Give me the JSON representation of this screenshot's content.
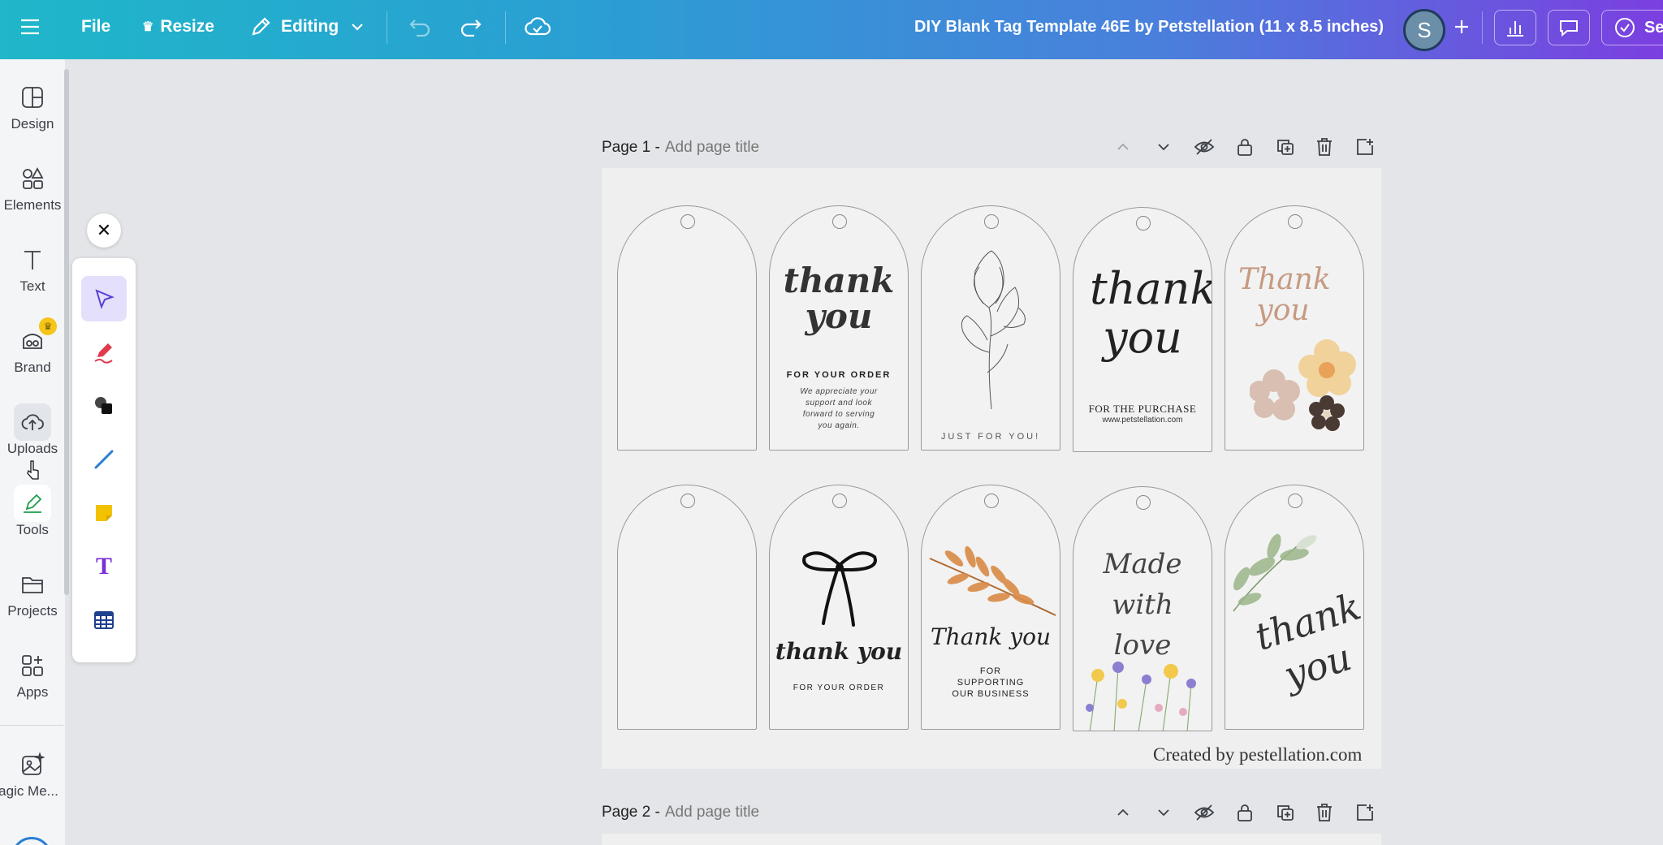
{
  "topbar": {
    "menu_label": "",
    "file_label": "File",
    "resize_label": "Resize",
    "editing_label": "Editing",
    "doc_title": "DIY Blank Tag Template 46E by Petstellation (11 x 8.5 inches)",
    "avatar_initial": "S",
    "share_label": "Se"
  },
  "sidebar": {
    "items": [
      {
        "label": "Design",
        "icon": "design-icon"
      },
      {
        "label": "Elements",
        "icon": "elements-icon"
      },
      {
        "label": "Text",
        "icon": "text-icon"
      },
      {
        "label": "Brand",
        "icon": "brand-icon"
      },
      {
        "label": "Uploads",
        "icon": "uploads-icon"
      },
      {
        "label": "Tools",
        "icon": "tools-icon"
      },
      {
        "label": "Projects",
        "icon": "projects-icon"
      },
      {
        "label": "Apps",
        "icon": "apps-icon"
      },
      {
        "label": "agic Me...",
        "icon": "magic-media-icon"
      }
    ]
  },
  "pages": [
    {
      "label": "Page 1 -",
      "title_placeholder": "Add page title"
    },
    {
      "label": "Page 2 -",
      "title_placeholder": "Add page title"
    }
  ],
  "tags": {
    "t2_title": "thank you",
    "t2_sub": "FOR YOUR ORDER",
    "t2_body": "We appreciate your support and look forward to serving you again.",
    "t3_sub": "JUST FOR YOU!",
    "t4_title": "thank you",
    "t4_sub": "FOR THE PURCHASE",
    "t4_url": "www.petstellation.com",
    "t5_title": "Thank you",
    "t7_title": "thank you",
    "t7_sub": "FOR YOUR ORDER",
    "t8_title": "Thank you",
    "t8_sub": "FOR SUPPORTING OUR BUSINESS",
    "t9_title": "Made with love",
    "t10_title": "thank you"
  },
  "credit": "Created by pestellation.com",
  "colors": {
    "topbar_start": "#1fb7c9",
    "topbar_end": "#7b3fe0",
    "tool_active_bg": "#e4dffb"
  }
}
